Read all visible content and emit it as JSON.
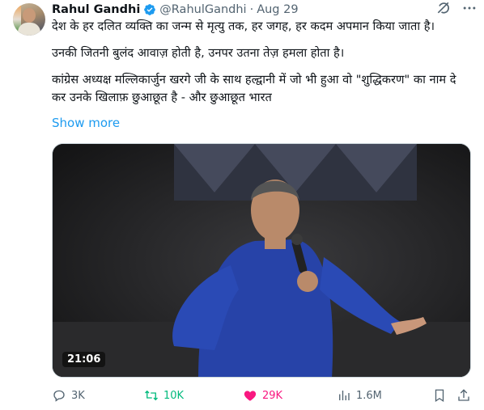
{
  "author": {
    "name": "Rahul Gandhi",
    "handle": "@RahulGandhi",
    "separator": "·",
    "date": "Aug 29"
  },
  "tweet": {
    "line1": "देश के हर दलित व्यक्ति का जन्म से मृत्यु तक, हर जगह, हर कदम अपमान किया जाता है।",
    "line2": "उनकी जितनी बुलंद आवाज़ होती है, उनपर उतना तेज़ हमला होता है।",
    "line3": "कांग्रेस अध्यक्ष मल्लिकार्जुन खरगे जी के साथ हल्द्वानी में जो भी हुआ वो \"शुद्धिकरण\" का नाम दे कर उनके खिलाफ़ छुआछूत है - और छुआछूत भारत",
    "show_more": "Show more"
  },
  "media": {
    "duration": "21:06"
  },
  "actions": {
    "replies": "3K",
    "reposts": "10K",
    "likes": "29K",
    "views": "1.6M"
  },
  "colors": {
    "accent": "#1d9bf0",
    "repost": "#00ba7c",
    "like": "#f91880",
    "muted": "#536471"
  },
  "icons": [
    "verified-badge-icon",
    "grok-icon",
    "more-icon",
    "reply-icon",
    "repost-icon",
    "like-icon",
    "views-icon",
    "bookmark-icon",
    "share-icon"
  ]
}
